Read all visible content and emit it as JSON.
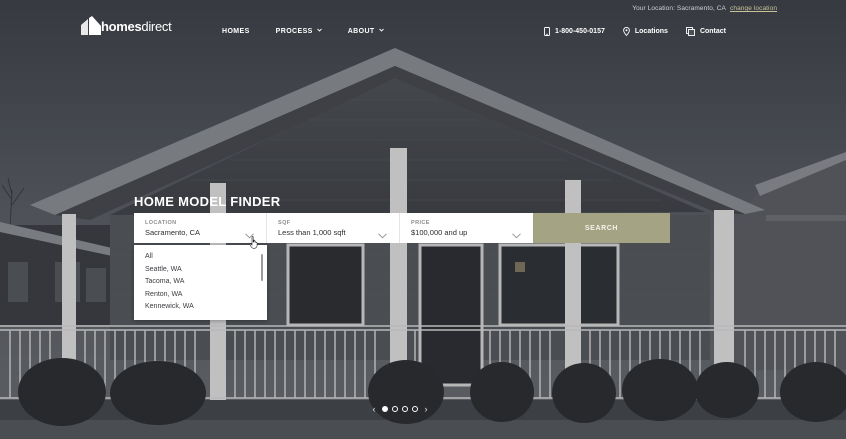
{
  "header": {
    "location_prefix": "Your Location: Sacramento, CA",
    "change_location": "change location",
    "brand_bold": "homes",
    "brand_light": "direct",
    "nav": [
      {
        "label": "HOMES"
      },
      {
        "label": "PROCESS"
      },
      {
        "label": "ABOUT"
      }
    ],
    "phone": "1-800-450-0157",
    "locations": "Locations",
    "contact": "Contact"
  },
  "finder": {
    "title": "HOME MODEL FINDER",
    "location_label": "LOCATION",
    "location_value": "Sacramento, CA",
    "sqf_label": "SQF",
    "sqf_value": "Less than 1,000 sqft",
    "price_label": "PRICE",
    "price_value": "$100,000 and up",
    "search_label": "SEARCH",
    "dropdown_options": [
      "All",
      "Seattle, WA",
      "Tacoma, WA",
      "Renton, WA",
      "Kennewick, WA"
    ]
  },
  "carousel": {
    "slide_count": 4,
    "active_index": 0
  },
  "colors": {
    "accent": "#a4a484",
    "link": "#c7c29a"
  },
  "icons": [
    "logo-mark-icon",
    "chevron-down-icon",
    "phone-icon",
    "location-pin-icon",
    "contact-card-icon",
    "cursor-hand-icon",
    "arrow-left-icon",
    "arrow-right-icon"
  ]
}
